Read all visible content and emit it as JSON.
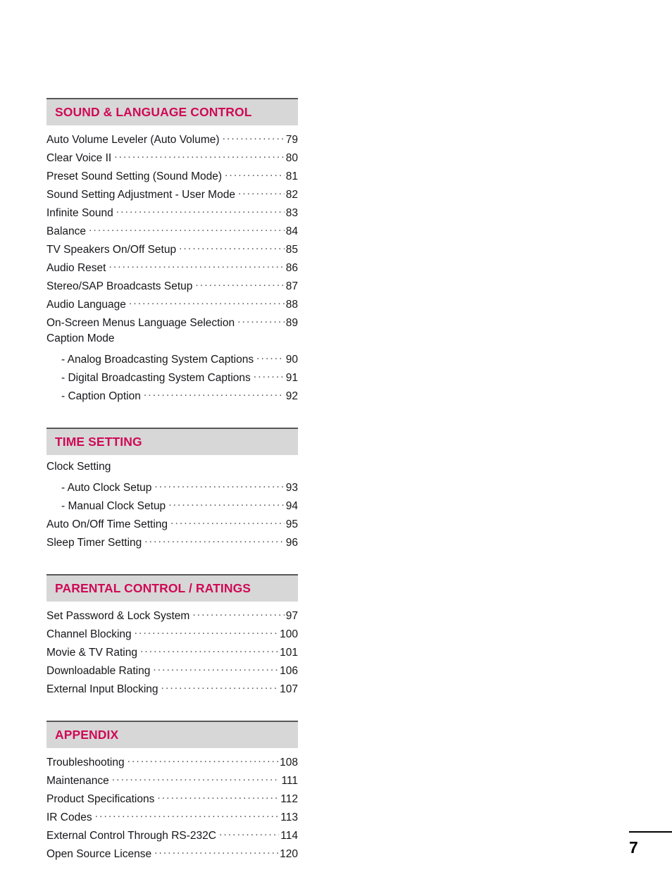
{
  "document": {
    "type": "table-of-contents",
    "folio": "7"
  },
  "colors": {
    "heading": "#CF0A56",
    "header_bar": "#D7D7D7",
    "header_rule": "#58585A",
    "body_text": "#16161A",
    "leader_dots": "#58585A"
  },
  "sections": [
    {
      "title": "SOUND & LANGUAGE CONTROL",
      "entries": [
        {
          "label": "Auto Volume Leveler (Auto Volume)",
          "page": "79",
          "level": 0
        },
        {
          "label": "Clear Voice II",
          "page": "80",
          "level": 0
        },
        {
          "label": "Preset Sound Setting (Sound Mode)",
          "page": "81",
          "level": 0
        },
        {
          "label": "Sound Setting Adjustment - User Mode",
          "page": "82",
          "level": 0
        },
        {
          "label": "Infinite Sound",
          "page": "83",
          "level": 0
        },
        {
          "label": "Balance",
          "page": "84",
          "level": 0
        },
        {
          "label": "TV Speakers On/Off Setup",
          "page": "85",
          "level": 0
        },
        {
          "label": "Audio Reset",
          "page": "86",
          "level": 0
        },
        {
          "label": "Stereo/SAP Broadcasts Setup",
          "page": "87",
          "level": 0
        },
        {
          "label": "Audio Language",
          "page": "88",
          "level": 0
        },
        {
          "label": "On-Screen Menus Language Selection",
          "page": "89",
          "level": 0
        },
        {
          "label": "Caption Mode",
          "page": "",
          "level": 0
        },
        {
          "label": "- Analog Broadcasting System Captions",
          "page": "90",
          "level": 1
        },
        {
          "label": "- Digital Broadcasting System Captions",
          "page": "91",
          "level": 1
        },
        {
          "label": "- Caption Option",
          "page": "92",
          "level": 1
        }
      ]
    },
    {
      "title": "TIME SETTING",
      "entries": [
        {
          "label": "Clock Setting",
          "page": "",
          "level": 0
        },
        {
          "label": "- Auto Clock Setup",
          "page": "93",
          "level": 1
        },
        {
          "label": "- Manual Clock Setup",
          "page": "94",
          "level": 1
        },
        {
          "label": "Auto On/Off Time Setting",
          "page": "95",
          "level": 0
        },
        {
          "label": "Sleep Timer Setting",
          "page": "96",
          "level": 0
        }
      ]
    },
    {
      "title": "PARENTAL CONTROL / RATINGS",
      "entries": [
        {
          "label": "Set Password & Lock System",
          "page": "97",
          "level": 0
        },
        {
          "label": "Channel Blocking",
          "page": "100",
          "level": 0
        },
        {
          "label": "Movie & TV Rating",
          "page": "101",
          "level": 0
        },
        {
          "label": "Downloadable Rating",
          "page": "106",
          "level": 0
        },
        {
          "label": "External Input Blocking",
          "page": "107",
          "level": 0
        }
      ]
    },
    {
      "title": "APPENDIX",
      "entries": [
        {
          "label": "Troubleshooting",
          "page": "108",
          "level": 0
        },
        {
          "label": "Maintenance",
          "page": "111",
          "level": 0
        },
        {
          "label": "Product Specifications",
          "page": "112",
          "level": 0
        },
        {
          "label": "IR Codes",
          "page": "113",
          "level": 0
        },
        {
          "label": "External Control Through RS-232C",
          "page": "114",
          "level": 0
        },
        {
          "label": "Open Source License",
          "page": "120",
          "level": 0
        }
      ]
    }
  ]
}
